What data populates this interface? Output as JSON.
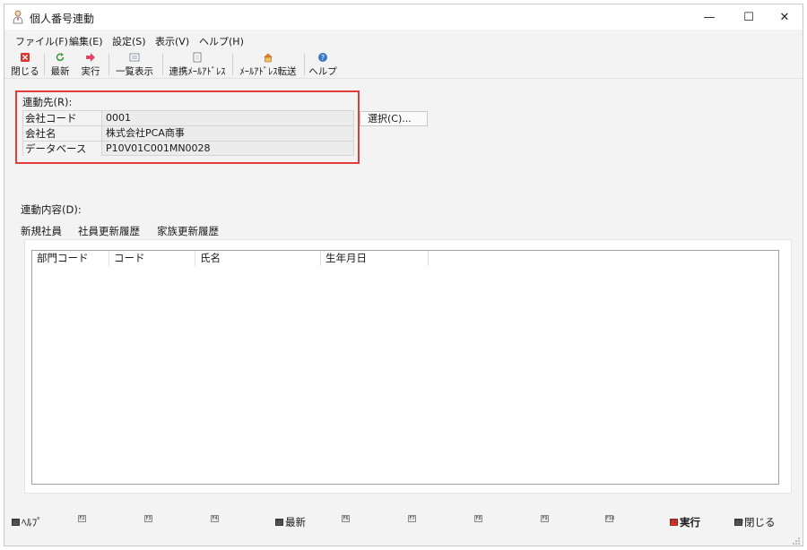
{
  "window": {
    "title": "個人番号連動",
    "minimize": "—",
    "maximize": "☐",
    "close": "✕"
  },
  "menu": [
    {
      "label": "ファイル(F)"
    },
    {
      "label": "編集(E)"
    },
    {
      "label": "設定(S)"
    },
    {
      "label": "表示(V)"
    },
    {
      "label": "ヘルプ(H)"
    }
  ],
  "toolbar": {
    "close": "閉じる",
    "refresh": "最新",
    "execute": "実行",
    "list_view": "一覧表示",
    "linked_mail": "連携ﾒｰﾙｱﾄﾞﾚｽ",
    "mail_transfer": "ﾒｰﾙｱﾄﾞﾚｽ転送",
    "help": "ヘルプ",
    "colors": {
      "close": "#d9342b",
      "refresh": "#3a9b3a",
      "execute": "#e0456a",
      "help": "#3c78c8"
    }
  },
  "destination": {
    "title": "連動先(R):",
    "rows": [
      {
        "label": "会社コード",
        "value": "0001"
      },
      {
        "label": "会社名",
        "value": "株式会社PCA商事"
      },
      {
        "label": "データベース",
        "value": "P10V01C001MN0028"
      }
    ],
    "select_button": "選択(C)..."
  },
  "content": {
    "title": "連動内容(D):",
    "tabs": [
      {
        "label": "新規社員"
      },
      {
        "label": "社員更新履歴"
      },
      {
        "label": "家族更新履歴"
      }
    ],
    "columns": [
      {
        "label": "部門コード"
      },
      {
        "label": "コード"
      },
      {
        "label": "氏名"
      },
      {
        "label": "生年月日"
      }
    ]
  },
  "fkeys": [
    {
      "key": "F1",
      "label": "ﾍﾙﾌﾟ"
    },
    {
      "key": "F2",
      "label": ""
    },
    {
      "key": "F3",
      "label": ""
    },
    {
      "key": "F4",
      "label": ""
    },
    {
      "key": "F5",
      "label": "最新"
    },
    {
      "key": "F6",
      "label": ""
    },
    {
      "key": "F7",
      "label": ""
    },
    {
      "key": "F8",
      "label": ""
    },
    {
      "key": "F9",
      "label": ""
    },
    {
      "key": "F10",
      "label": ""
    },
    {
      "key": "F11",
      "label": "実行"
    },
    {
      "key": "F12",
      "label": "閉じる"
    }
  ],
  "accent": {
    "highlight_border": "#e03c3c"
  }
}
